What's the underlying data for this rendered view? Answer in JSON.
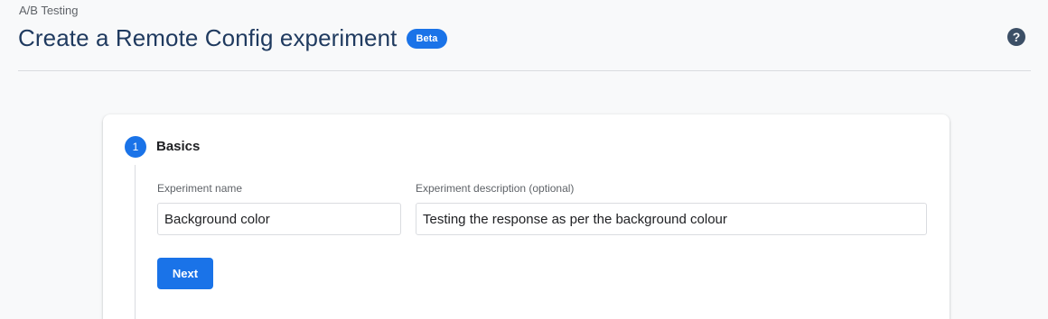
{
  "header": {
    "breadcrumb": "A/B Testing",
    "title": "Create a Remote Config experiment",
    "badge": "Beta",
    "help_icon": "help-circle-icon",
    "help_glyph": "?"
  },
  "colors": {
    "accent": "#1a73e8",
    "title": "#1f3a5f",
    "background": "#f8f9fa"
  },
  "step": {
    "number": "1",
    "title": "Basics",
    "fields": {
      "name": {
        "label": "Experiment name",
        "value": "Background color"
      },
      "description": {
        "label": "Experiment description (optional)",
        "value": "Testing the response as per the background colour"
      }
    },
    "next_label": "Next"
  }
}
